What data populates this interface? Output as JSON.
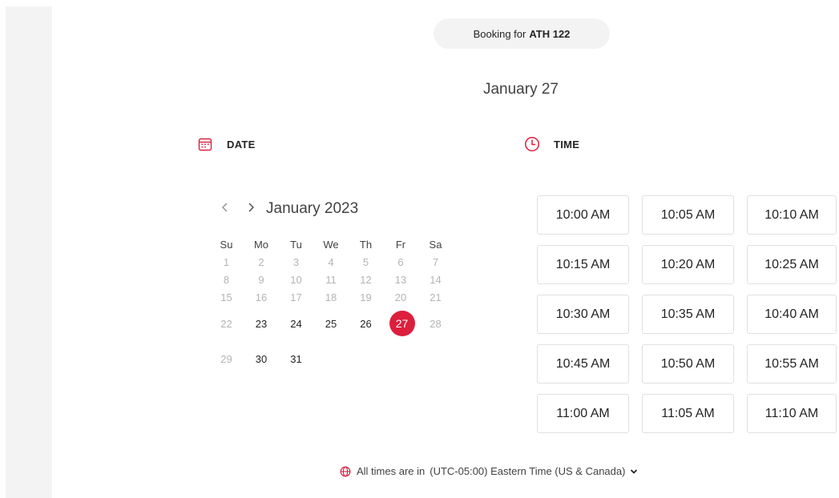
{
  "booking": {
    "prefix": "Booking for",
    "resource": "ATH 122"
  },
  "selected_date_title": "January 27",
  "date_section": {
    "label": "DATE",
    "icon": "calendar-icon"
  },
  "time_section": {
    "label": "TIME",
    "icon": "clock-icon"
  },
  "calendar": {
    "month_label": "January 2023",
    "prev_icon": "chevron-left-icon",
    "next_icon": "chevron-right-icon",
    "weekdays": [
      "Su",
      "Mo",
      "Tu",
      "We",
      "Th",
      "Fr",
      "Sa"
    ],
    "weeks": [
      [
        "1",
        "2",
        "3",
        "4",
        "5",
        "6",
        "7"
      ],
      [
        "8",
        "9",
        "10",
        "11",
        "12",
        "13",
        "14"
      ],
      [
        "15",
        "16",
        "17",
        "18",
        "19",
        "20",
        "21"
      ],
      [
        "22",
        "23",
        "24",
        "25",
        "26",
        "27",
        "28"
      ],
      [
        "29",
        "30",
        "31"
      ]
    ],
    "enabled_days": [
      "23",
      "24",
      "25",
      "26",
      "27",
      "30",
      "31"
    ],
    "selected_day": "27"
  },
  "time_slots": [
    "10:00 AM",
    "10:05 AM",
    "10:10 AM",
    "10:15 AM",
    "10:20 AM",
    "10:25 AM",
    "10:30 AM",
    "10:35 AM",
    "10:40 AM",
    "10:45 AM",
    "10:50 AM",
    "10:55 AM",
    "11:00 AM",
    "11:05 AM",
    "11:10 AM"
  ],
  "timezone": {
    "prefix": "All times are in",
    "value": "(UTC-05:00) Eastern Time (US & Canada)",
    "icon": "globe-icon"
  },
  "colors": {
    "accent": "#dc1f3d",
    "rail": "#f3f3f3",
    "pill": "#f3f3f3"
  }
}
